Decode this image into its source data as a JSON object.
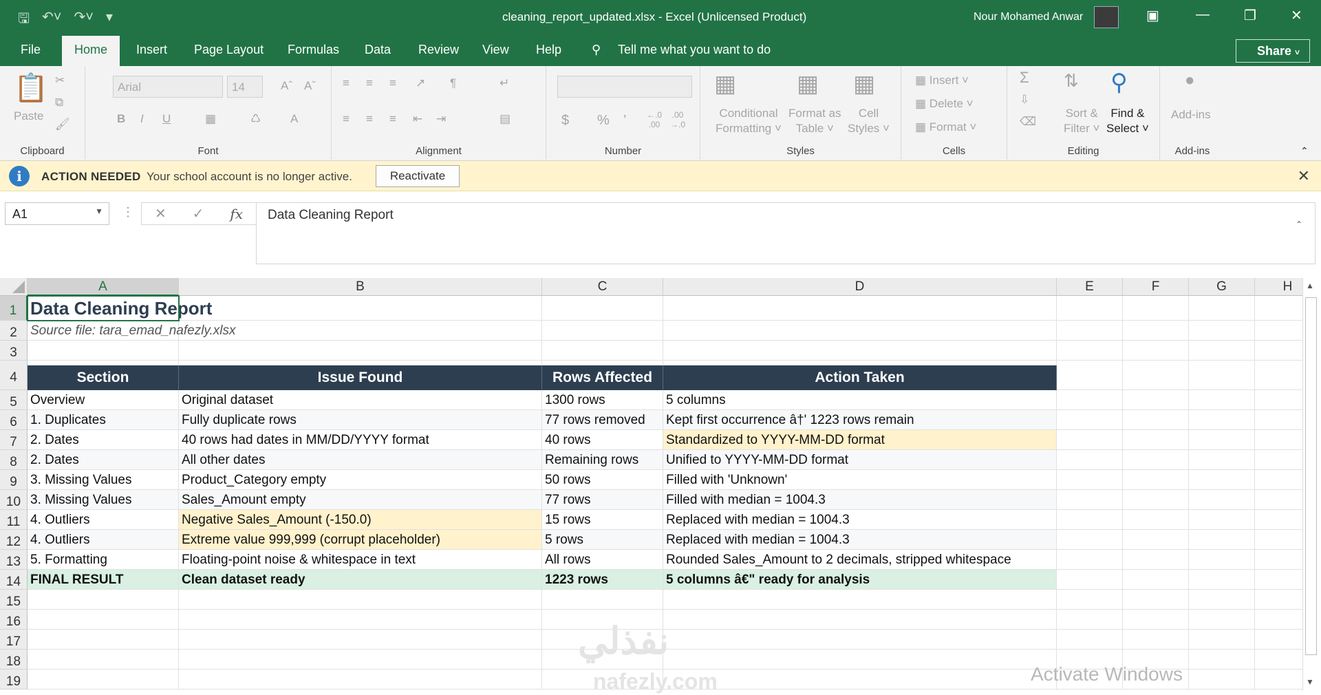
{
  "window": {
    "title": "cleaning_report_updated.xlsx  -  Excel (Unlicensed Product)",
    "user": "Nour Mohamed Anwar",
    "share_label": "Share"
  },
  "tabs": [
    "File",
    "Home",
    "Insert",
    "Page Layout",
    "Formulas",
    "Data",
    "Review",
    "View",
    "Help"
  ],
  "tell_me": "Tell me what you want to do",
  "ribbon": {
    "clipboard": {
      "label": "Clipboard",
      "paste": "Paste"
    },
    "font": {
      "label": "Font",
      "font_name": "Arial",
      "font_size": "14"
    },
    "alignment": {
      "label": "Alignment"
    },
    "number": {
      "label": "Number"
    },
    "styles": {
      "label": "Styles",
      "conditional_1": "Conditional",
      "conditional_2": "Formatting",
      "format_as_1": "Format as",
      "format_as_2": "Table",
      "cell_styles_1": "Cell",
      "cell_styles_2": "Styles"
    },
    "cells": {
      "label": "Cells",
      "insert": "Insert",
      "delete": "Delete",
      "format": "Format"
    },
    "editing": {
      "label": "Editing",
      "sort_1": "Sort &",
      "sort_2": "Filter",
      "find_1": "Find &",
      "find_2": "Select"
    },
    "addins": {
      "label": "Add-ins",
      "addins_btn": "Add-ins"
    }
  },
  "message_bar": {
    "title": "ACTION NEEDED",
    "text": "Your school account is no longer active.",
    "button": "Reactivate"
  },
  "formula_bar": {
    "name_box": "A1",
    "formula": "Data Cleaning Report"
  },
  "sheet": {
    "columns": [
      "A",
      "B",
      "C",
      "D",
      "E",
      "F",
      "G",
      "H"
    ],
    "rows": [
      "1",
      "2",
      "3",
      "4",
      "5",
      "6",
      "7",
      "8",
      "9",
      "10",
      "11",
      "12",
      "13",
      "14",
      "15",
      "16",
      "17",
      "18",
      "19"
    ],
    "title": "Data Cleaning Report",
    "source": "Source file: tara_emad_nafezly.xlsx",
    "headers": [
      "Section",
      "Issue Found",
      "Rows Affected",
      "Action Taken"
    ],
    "data": [
      [
        "Overview",
        "Original dataset",
        "1300 rows",
        "5 columns"
      ],
      [
        "1. Duplicates",
        "Fully duplicate rows",
        "77 rows removed",
        "Kept first occurrence â†' 1223 rows remain"
      ],
      [
        "2. Dates",
        "40 rows had dates in MM/DD/YYYY format",
        "40 rows",
        "Standardized to YYYY-MM-DD format"
      ],
      [
        "2. Dates",
        "All other dates",
        "Remaining rows",
        "Unified to YYYY-MM-DD format"
      ],
      [
        "3. Missing Values",
        "Product_Category empty",
        "50 rows",
        "Filled with 'Unknown'"
      ],
      [
        "3. Missing Values",
        "Sales_Amount empty",
        "77 rows",
        "Filled with median = 1004.3"
      ],
      [
        "4. Outliers",
        "Negative Sales_Amount (-150.0)",
        "15 rows",
        "Replaced with median = 1004.3"
      ],
      [
        "4. Outliers",
        "Extreme value 999,999 (corrupt placeholder)",
        "5 rows",
        "Replaced with median = 1004.3"
      ],
      [
        "5. Formatting",
        "Floating-point noise & whitespace in text",
        "All rows",
        "Rounded Sales_Amount to 2 decimals, stripped whitespace"
      ],
      [
        "FINAL RESULT",
        "Clean dataset ready",
        "1223 rows",
        "5 columns â€\" ready for analysis"
      ]
    ]
  },
  "watermark": "Activate Windows",
  "brand_ar": "نفذلي",
  "brand_en": "nafezly.com",
  "colors": {
    "excel_green": "#217346",
    "header_navy": "#2d3e50",
    "highlight_yellow": "#fff2cc",
    "final_green": "#d9f0e3",
    "message_yellow": "#fff4ce"
  }
}
